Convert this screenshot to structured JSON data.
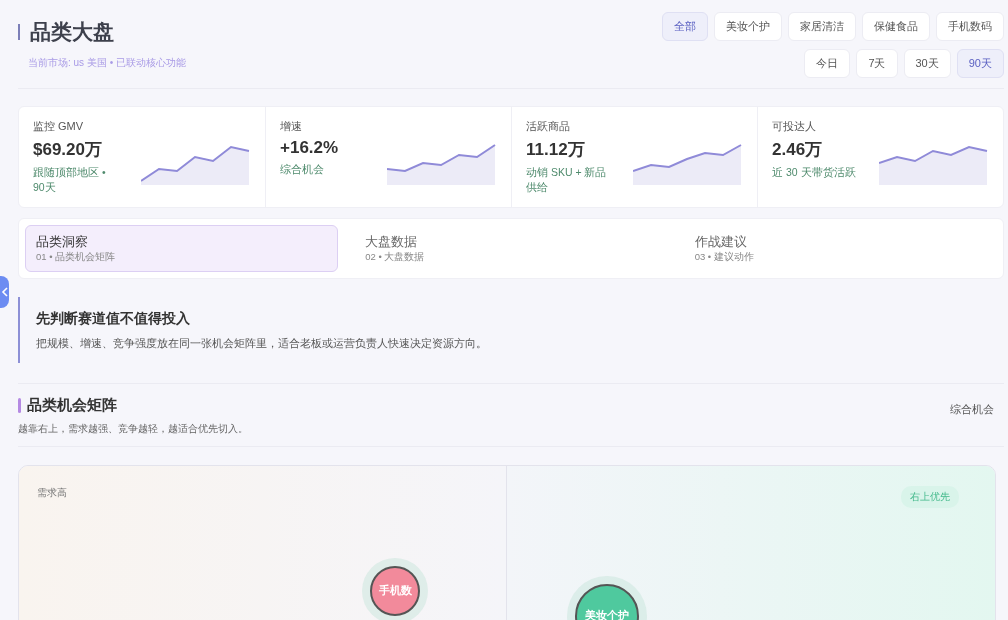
{
  "header": {
    "title": "品类大盘",
    "subtitle": "当前市场: us 美国 • 已联动核心功能"
  },
  "categories": [
    {
      "label": "全部",
      "selected": true
    },
    {
      "label": "美妆个护",
      "selected": false
    },
    {
      "label": "家居清洁",
      "selected": false
    },
    {
      "label": "保健食品",
      "selected": false
    },
    {
      "label": "手机数码",
      "selected": false
    }
  ],
  "periods": [
    {
      "label": "今日",
      "selected": false
    },
    {
      "label": "7天",
      "selected": false
    },
    {
      "label": "30天",
      "selected": false
    },
    {
      "label": "90天",
      "selected": true
    }
  ],
  "kpis": [
    {
      "label": "监控 GMV",
      "value": "$69.20万",
      "note": "跟随顶部地区 • 90天"
    },
    {
      "label": "增速",
      "value": "+16.2%",
      "note": "综合机会"
    },
    {
      "label": "活跃商品",
      "value": "11.12万",
      "note": "动销 SKU + 新品供给"
    },
    {
      "label": "可投达人",
      "value": "2.46万",
      "note": "近 30 天带货活跃"
    }
  ],
  "tabs": [
    {
      "title": "品类洞察",
      "sub": "01 • 品类机会矩阵",
      "selected": true
    },
    {
      "title": "大盘数据",
      "sub": "02 • 大盘数据",
      "selected": false
    },
    {
      "title": "作战建议",
      "sub": "03 • 建议动作",
      "selected": false
    }
  ],
  "callout": {
    "title": "先判断赛道值不值得投入",
    "text": "把规模、增速、竞争强度放在同一张机会矩阵里，适合老板或运营负责人快速决定资源方向。"
  },
  "matrix": {
    "title": "品类机会矩阵",
    "desc": "越靠右上，需求越强、竞争越轻，越适合优先切入。",
    "mode": "综合机会",
    "y_axis_label": "需求高",
    "badge": "右上优先",
    "bubbles": [
      {
        "label": "手机数",
        "color": "#f28a9b"
      },
      {
        "label": "美妆个护",
        "color": "#4fc99e"
      }
    ]
  }
}
